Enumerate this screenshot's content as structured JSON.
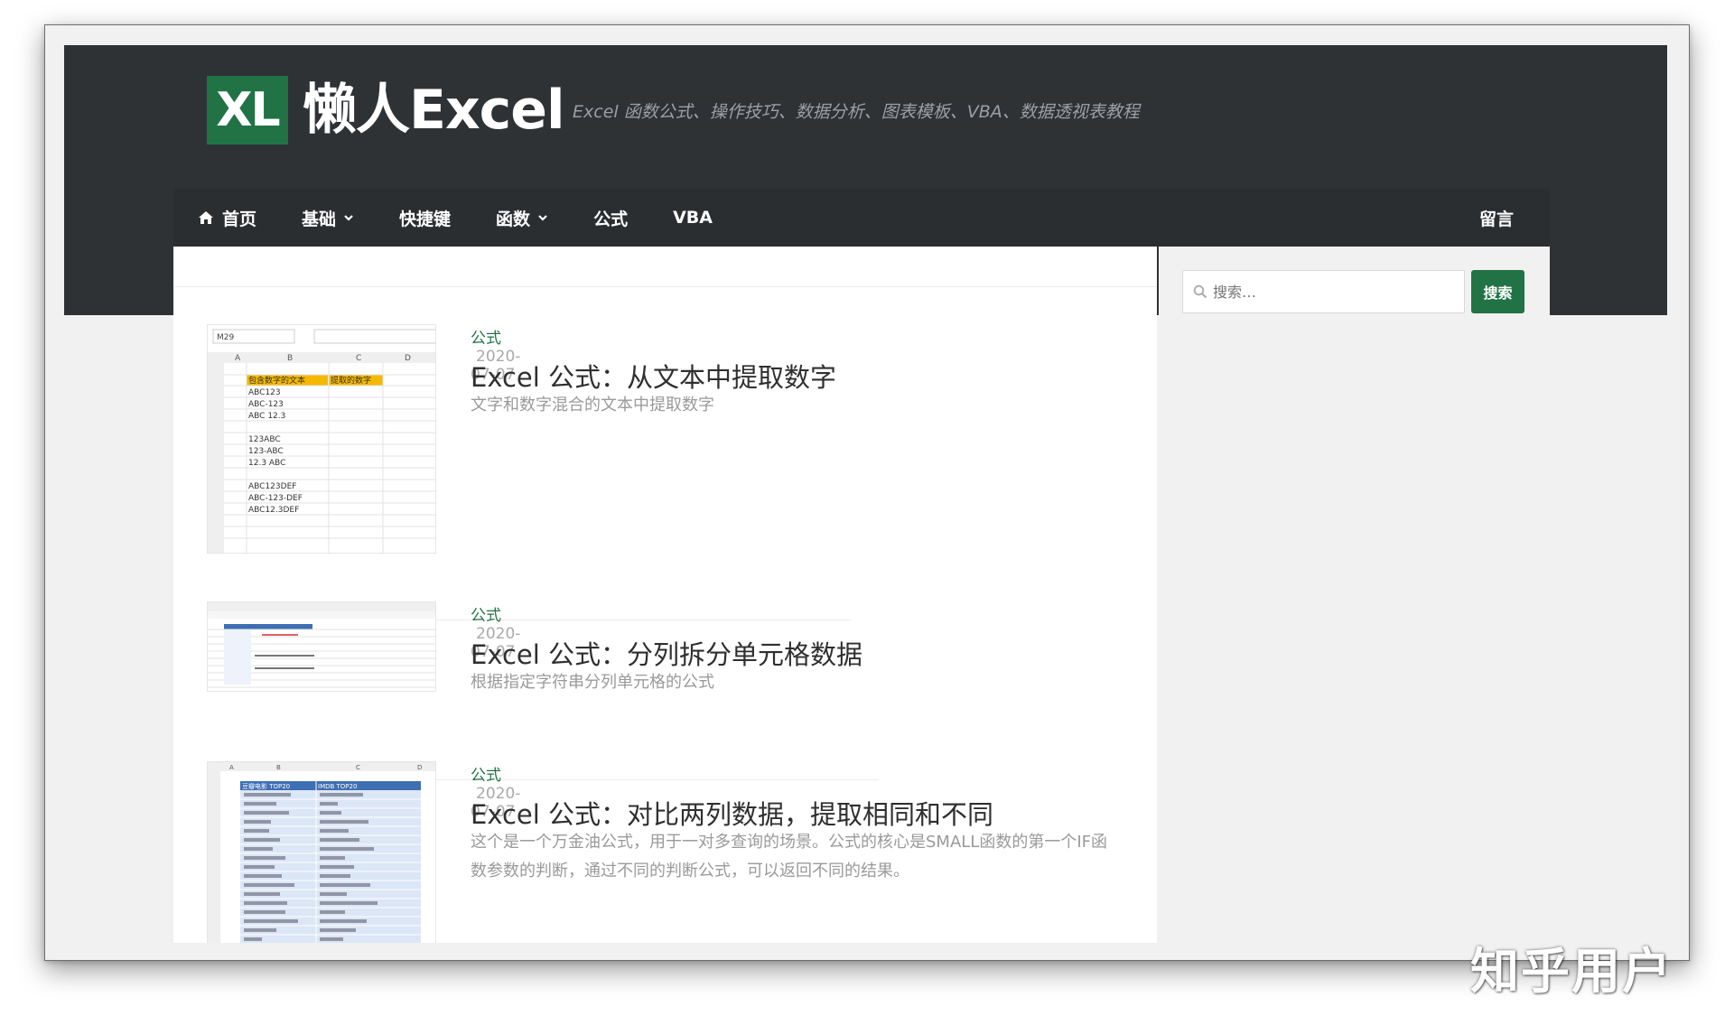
{
  "site": {
    "logo_badge": "XL",
    "logo_name": "懒人Excel",
    "tagline": "Excel 函数公式、操作技巧、数据分析、图表模板、VBA、数据透视表教程"
  },
  "nav": {
    "items": [
      {
        "label": "首页",
        "icon": "home-icon"
      },
      {
        "label": "基础",
        "dropdown": true
      },
      {
        "label": "快捷键"
      },
      {
        "label": "函数",
        "dropdown": true
      },
      {
        "label": "公式"
      },
      {
        "label": "VBA"
      }
    ],
    "right_label": "留言"
  },
  "posts": [
    {
      "category": "公式",
      "date": "2020-07-07",
      "title": "Excel 公式：从文本中提取数字",
      "excerpt": "文字和数字混合的文本中提取数字",
      "thumb": {
        "name_box": "M29",
        "columns": [
          "A",
          "B",
          "C",
          "D"
        ],
        "header": [
          "包含数字的文本",
          "提取的数字"
        ],
        "rows": [
          "",
          "",
          "ABC123",
          "ABC-123",
          "ABC 12.3",
          "",
          "123ABC",
          "123-ABC",
          "12.3 ABC",
          "",
          "ABC123DEF",
          "ABC-123-DEF",
          "ABC12.3DEF",
          "",
          "",
          ""
        ]
      }
    },
    {
      "category": "公式",
      "date": "2020-07-07",
      "title": "Excel 公式：分列拆分单元格数据",
      "excerpt": "根据指定字符串分列单元格的公式"
    },
    {
      "category": "公式",
      "date": "2020-07-07",
      "title": "Excel 公式：对比两列数据，提取相同和不同",
      "excerpt": "这个是一个万金油公式，用于一对多查询的场景。公式的核心是SMALL函数的第一个IF函数参数的判断，通过不同的判断公式，可以返回不同的结果。",
      "thumb": {
        "columns": [
          "A",
          "B",
          "C",
          "D"
        ],
        "header": [
          "豆瓣电影 TOP20",
          "IMDB TOP20"
        ]
      }
    }
  ],
  "search": {
    "placeholder": "搜索…",
    "button_label": "搜索"
  },
  "watermark": "知乎用户",
  "colors": {
    "brand_green": "#217346",
    "header_dark": "#2f3235",
    "excel_highlight": "#f5b800",
    "table_blue": "#3f6fb3"
  }
}
